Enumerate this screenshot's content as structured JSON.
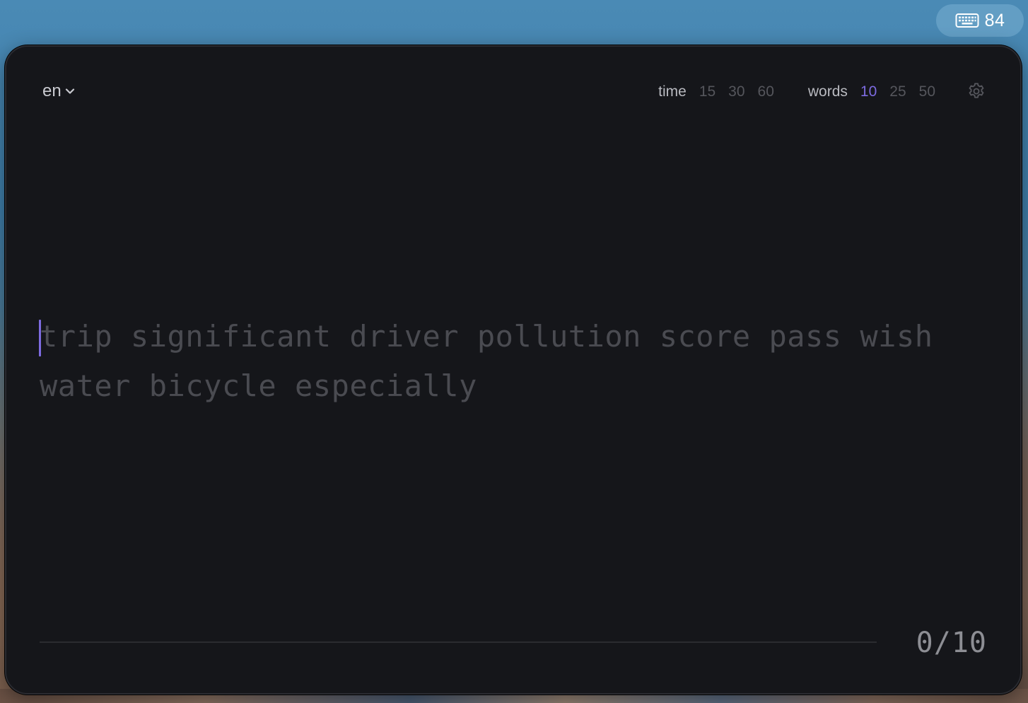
{
  "menubar": {
    "icon": "keyboard-icon",
    "count": "84"
  },
  "header": {
    "language": "en",
    "modes": {
      "time": {
        "label": "time",
        "options": [
          "15",
          "30",
          "60"
        ]
      },
      "words": {
        "label": "words",
        "options": [
          "10",
          "25",
          "50"
        ],
        "selected": "10"
      }
    },
    "settings_icon": "gear-icon"
  },
  "typing": {
    "lines": [
      "trip significant driver pollution score pass wish",
      "water bicycle especially"
    ],
    "typed_chars": 0
  },
  "progress": {
    "count_text": "0/10",
    "fraction": 0
  },
  "colors": {
    "accent": "#7d6be0",
    "window_bg": "#15161a",
    "text_untyped": "#4a4b51",
    "text_label": "#b9bac0",
    "text_dim": "#55565c"
  }
}
